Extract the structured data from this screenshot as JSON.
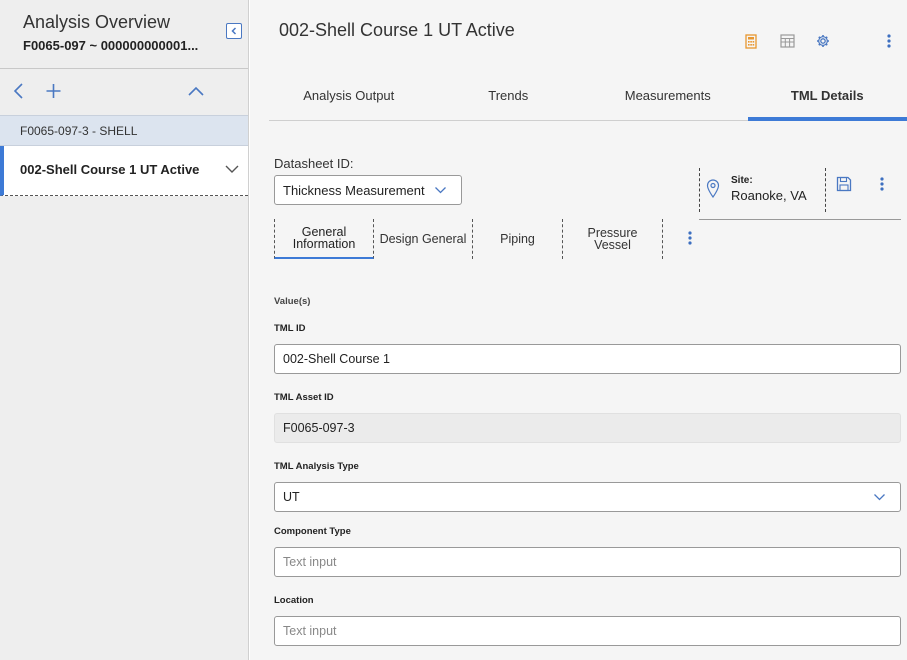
{
  "left": {
    "title": "Analysis Overview",
    "subtitle": "F0065-097 ~ 000000000001...",
    "parent_node": "F0065-097-3 - SHELL",
    "active_node": "002-Shell Course 1 UT Active"
  },
  "header": {
    "title": "002-Shell Course 1 UT Active"
  },
  "tabs": [
    {
      "label": "Analysis Output"
    },
    {
      "label": "Trends"
    },
    {
      "label": "Measurements"
    },
    {
      "label": "TML Details",
      "active": true
    }
  ],
  "datasheet": {
    "label": "Datasheet ID:",
    "value": "Thickness Measurement"
  },
  "site": {
    "label": "Site:",
    "value": "Roanoke, VA"
  },
  "subtabs": [
    {
      "label": "General Information",
      "active": true
    },
    {
      "label": "Design General"
    },
    {
      "label": "Piping"
    },
    {
      "label": "Pressure Vessel"
    }
  ],
  "form": {
    "section_label": "Value(s)",
    "fields": [
      {
        "label": "TML ID",
        "value": "002-Shell Course 1"
      },
      {
        "label": "TML Asset ID",
        "value": "F0065-097-3"
      },
      {
        "label": "TML Analysis Type",
        "value": "UT"
      },
      {
        "label": "Component Type",
        "placeholder": "Text input"
      },
      {
        "label": "Location",
        "placeholder": "Text input"
      }
    ]
  },
  "colors": {
    "accent": "#3d7ad6",
    "calculator_icon": "#e8962e",
    "selected_node_bg": "#dce4ef"
  }
}
